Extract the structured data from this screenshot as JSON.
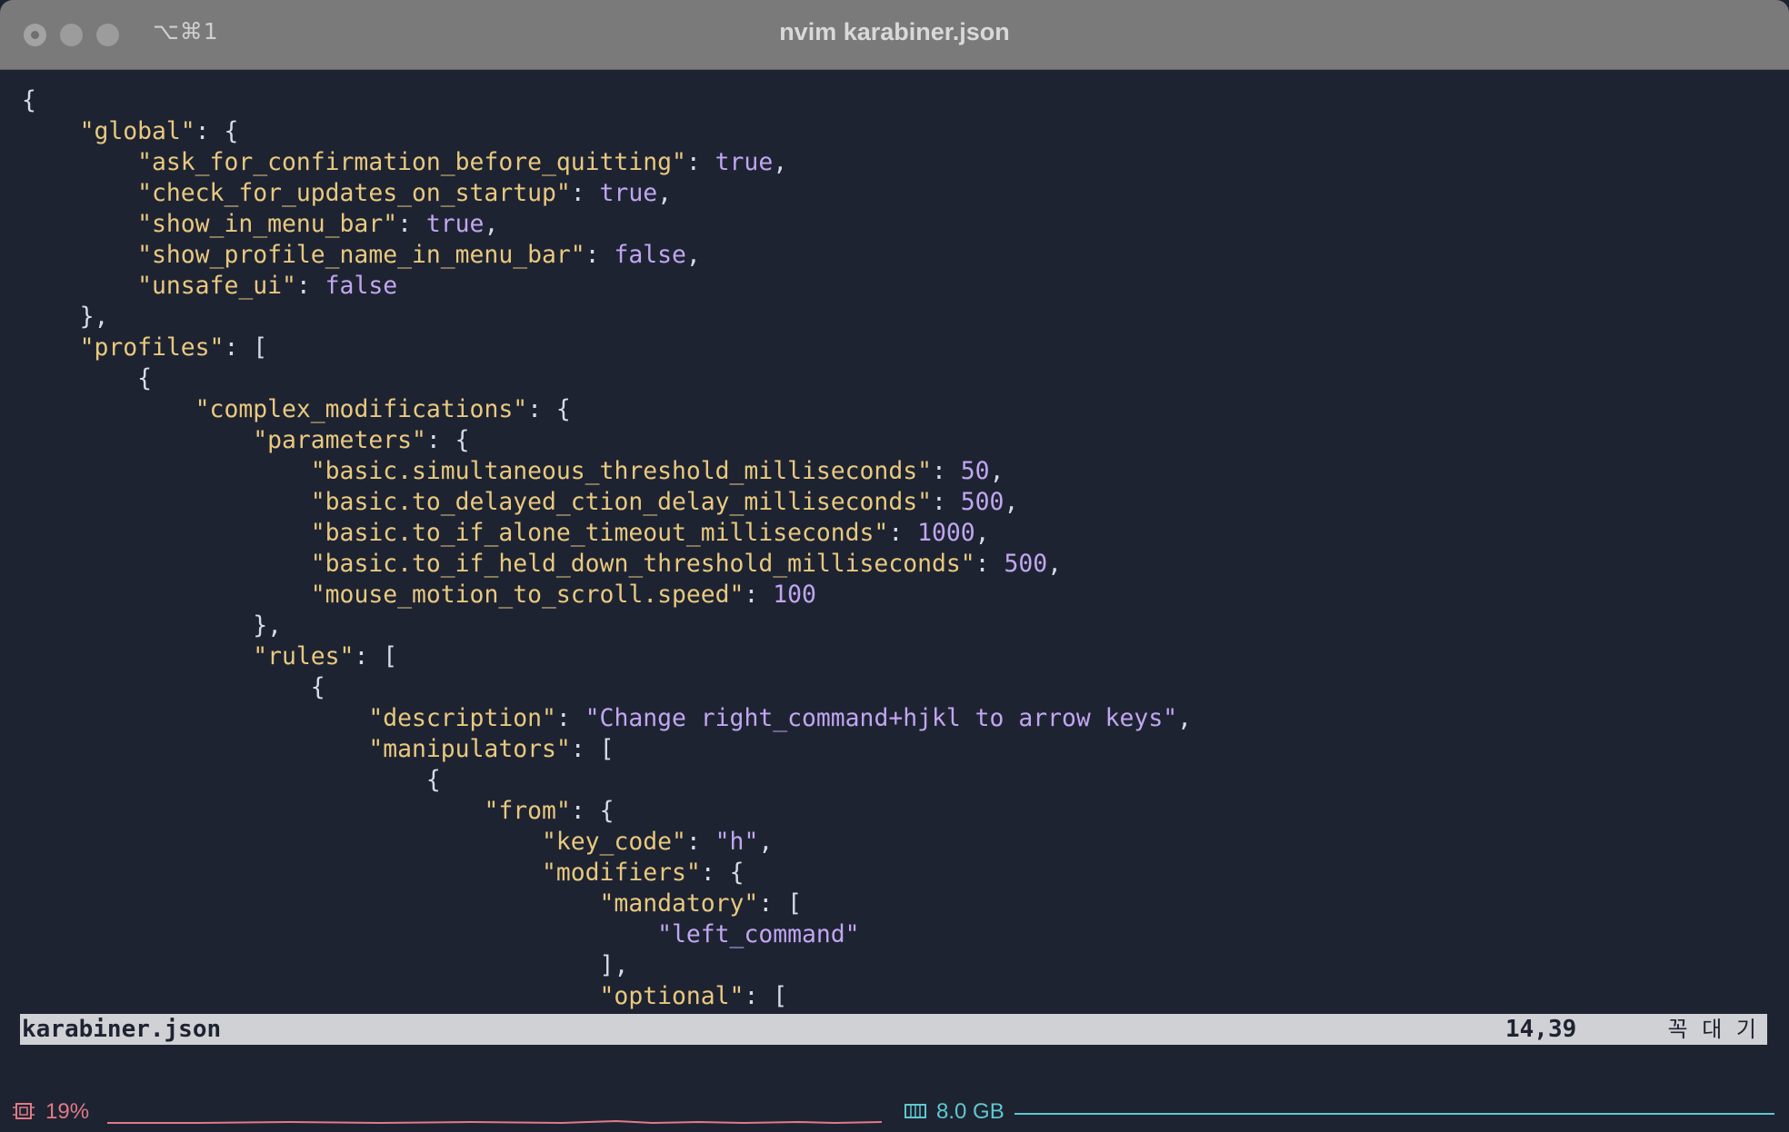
{
  "window": {
    "title": "nvim karabiner.json",
    "shortcut": "⌥⌘1"
  },
  "editor": {
    "lines": [
      "{",
      "    \"global\": {",
      "        \"ask_for_confirmation_before_quitting\": true,",
      "        \"check_for_updates_on_startup\": true,",
      "        \"show_in_menu_bar\": true,",
      "        \"show_profile_name_in_menu_bar\": false,",
      "        \"unsafe_ui\": false",
      "    },",
      "    \"profiles\": [",
      "        {",
      "            \"complex_modifications\": {",
      "                \"parameters\": {",
      "                    \"basic.simultaneous_threshold_milliseconds\": 50,",
      "                    \"basic.to_delayed_action_delay_milliseconds\": 500,",
      "                    \"basic.to_if_alone_timeout_milliseconds\": 1000,",
      "                    \"basic.to_if_held_down_threshold_milliseconds\": 500,",
      "                    \"mouse_motion_to_scroll.speed\": 100",
      "                },",
      "                \"rules\": [",
      "                    {",
      "                        \"description\": \"Change right_command+hjkl to arrow keys\",",
      "                        \"manipulators\": [",
      "                            {",
      "                                \"from\": {",
      "                                    \"key_code\": \"h\",",
      "                                    \"modifiers\": {",
      "                                        \"mandatory\": [",
      "                                            \"left_command\"",
      "                                        ],",
      "                                        \"optional\": ["
    ],
    "cursor": {
      "line": 14,
      "column": 39
    }
  },
  "statusline": {
    "filename": "karabiner.json",
    "position": "14,39",
    "mode": "꼭 대 기"
  },
  "bottombar": {
    "cpu_label": "19%",
    "memory_label": "8.0 GB",
    "cpu_color": "#e07b86",
    "memory_color": "#5ec8cf"
  }
}
